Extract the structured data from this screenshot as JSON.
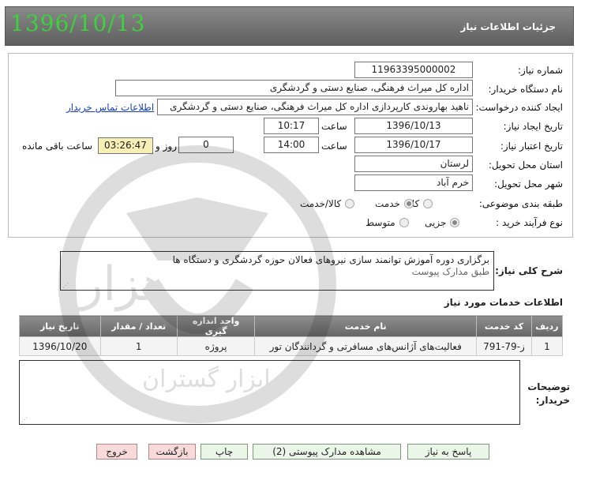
{
  "header": {
    "date": "1396/10/13",
    "title": "جزئیات اطلاعات نیاز"
  },
  "fields": {
    "need_number_label": "شماره نیاز:",
    "need_number": "11963395000002",
    "buyer_org_label": "نام دستگاه خریدار:",
    "buyer_org": "اداره کل میراث فرهنگی، صنایع دستی و گردشگری",
    "requester_label": "ایجاد کننده درخواست:",
    "requester": "ناهید بهاروندی کارپردازی اداره کل میراث فرهنگی، صنایع دستی و گردشگری",
    "contact_link": "اطلاعات تماس خریدار",
    "created_label": "تاریخ ایجاد نیاز:",
    "created_date": "1396/10/13",
    "time_label": "ساعت",
    "created_time": "10:17",
    "valid_label": "تاریخ اعتبار نیاز:",
    "valid_date": "1396/10/17",
    "valid_time": "14:00",
    "days": "0",
    "day_and": "روز و",
    "remaining_time": "03:26:47",
    "remaining_label": "ساعت باقی مانده",
    "province_label": "استان محل تحویل:",
    "province": "لرستان",
    "city_label": "شهر محل تحویل:",
    "city": "خرم آباد",
    "category_label": "طبقه بندی موضوعی:",
    "category_options": [
      "کالا",
      "خدمت",
      "کالا/خدمت"
    ],
    "purchase_label": "نوع فرآیند خرید :",
    "purchase_options": [
      "جزیی",
      "متوسط"
    ]
  },
  "description": {
    "label": "شرح کلی نیاز:",
    "line1": "برگزاری دوره آموزش توانمند سازی نیروهای فعالان حوزه گردشگری و دستگاه ها",
    "line2": "طبق مدارک پیوست"
  },
  "services": {
    "title": "اطلاعات خدمات مورد نیاز",
    "headers": [
      "ردیف",
      "کد خدمت",
      "نام خدمت",
      "واحد اندازه گیری",
      "تعداد / مقدار",
      "تاریخ نیاز"
    ],
    "rows": [
      [
        "1",
        "ز-79-791",
        "فعالیت‌های آژانس‌های مسافرتی و گردانندگان تور",
        "پروژه",
        "1",
        "1396/10/20"
      ]
    ]
  },
  "notes": {
    "label": "توضیحات خریدار:"
  },
  "buttons": {
    "reply": "پاسخ به نیاز",
    "attachments": "مشاهده مدارک پیوستی (2)",
    "print": "چاپ",
    "back": "بازگشت",
    "exit": "خروج"
  },
  "watermark": {
    "word1": "هزاره",
    "word2": "ابزار گستران"
  },
  "colors": {
    "date_green": "#3bd23b",
    "header_gray": "#6f6f6f",
    "link_blue": "#1a3fbf",
    "button_green": "#eaf6e8",
    "button_pink": "#f8dada"
  }
}
